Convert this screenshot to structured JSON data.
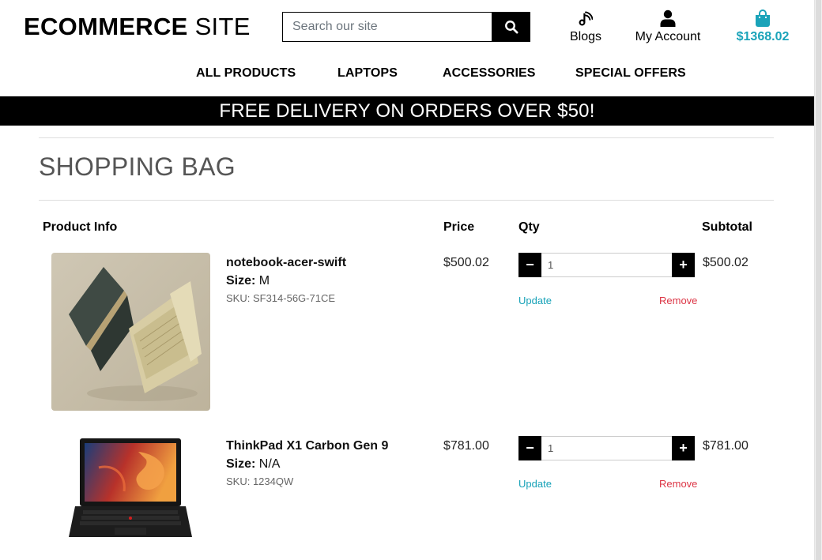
{
  "header": {
    "logo_bold": "ECOMMERCE",
    "logo_light": "SITE",
    "search_placeholder": "Search our site",
    "blogs_label": "Blogs",
    "account_label": "My Account",
    "bag_total": "$1368.02",
    "icons": {
      "search": "search-icon",
      "blogs": "rss-icon",
      "account": "user-icon",
      "bag": "shopping-bag-icon"
    },
    "accent_color": "#1aa3b9"
  },
  "nav": {
    "items": [
      {
        "label": "ALL PRODUCTS"
      },
      {
        "label": "LAPTOPS"
      },
      {
        "label": "ACCESSORIES"
      },
      {
        "label": "SPECIAL OFFERS"
      }
    ]
  },
  "banner": {
    "text": "FREE DELIVERY ON ORDERS OVER $50!"
  },
  "bag": {
    "title": "SHOPPING BAG",
    "columns": {
      "product": "Product Info",
      "price": "Price",
      "qty": "Qty",
      "subtotal": "Subtotal"
    },
    "items": [
      {
        "name": "notebook-acer-swift",
        "size_label": "Size:",
        "size": "M",
        "sku": "SKU: SF314-56G-71CE",
        "price": "$500.02",
        "qty": "1",
        "subtotal": "$500.02",
        "update_label": "Update",
        "remove_label": "Remove"
      },
      {
        "name": "ThinkPad X1 Carbon Gen 9",
        "size_label": "Size:",
        "size": "N/A",
        "sku": "SKU: 1234QW",
        "price": "$781.00",
        "qty": "1",
        "subtotal": "$781.00",
        "update_label": "Update",
        "remove_label": "Remove"
      }
    ],
    "qty_decrement_glyph": "−",
    "qty_increment_glyph": "+",
    "update_color": "#17a2b8",
    "remove_color": "#dc3545"
  }
}
